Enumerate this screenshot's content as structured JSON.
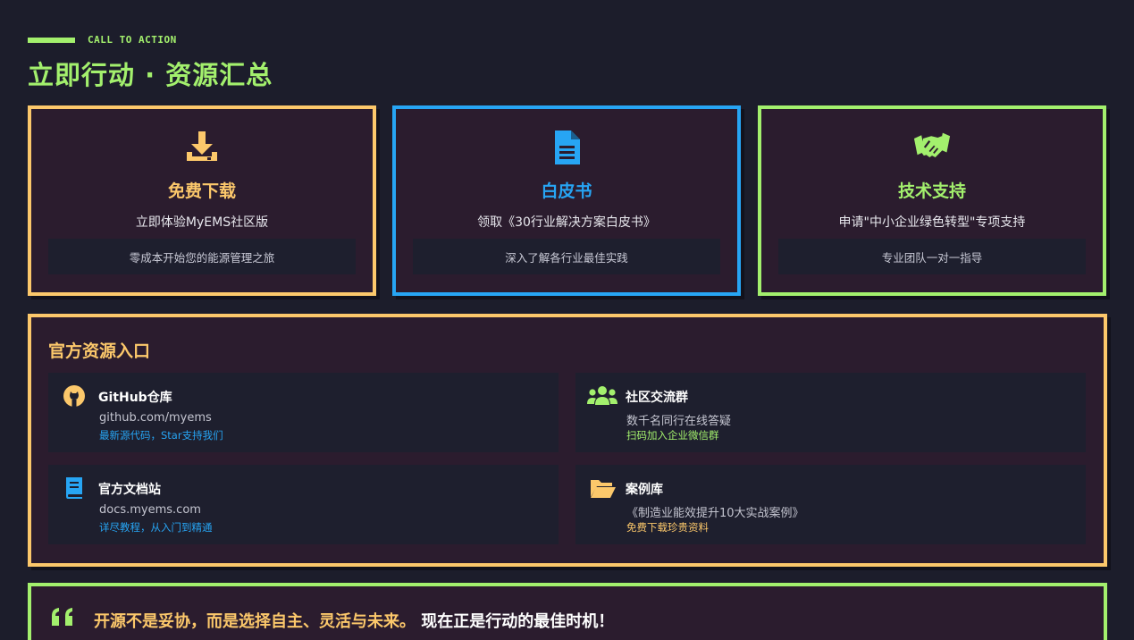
{
  "header": {
    "eyebrow": "CALL TO ACTION",
    "title": "立即行动 · 资源汇总"
  },
  "cards": [
    {
      "icon": "download-icon",
      "title": "免费下载",
      "subtitle": "立即体验MyEMS社区版",
      "note": "零成本开始您的能源管理之旅",
      "color": "#fcc86b"
    },
    {
      "icon": "document-icon",
      "title": "白皮书",
      "subtitle": "领取《30行业解决方案白皮书》",
      "note": "深入了解各行业最佳实践",
      "color": "#27a5f4"
    },
    {
      "icon": "handshake-icon",
      "title": "技术支持",
      "subtitle": "申请\"中小企业绿色转型\"专项支持",
      "note": "专业团队一对一指导",
      "color": "#a3f06d"
    }
  ],
  "resources": {
    "title": "官方资源入口",
    "items": [
      {
        "icon": "github-icon",
        "name": "GitHub仓库",
        "line": "github.com/myems",
        "link": "最新源代码，Star支持我们",
        "color": "#27a5f4"
      },
      {
        "icon": "users-icon",
        "name": "社区交流群",
        "line": "数千名同行在线答疑",
        "link": "扫码加入企业微信群",
        "color": "#a3f06d"
      },
      {
        "icon": "book-icon",
        "name": "官方文档站",
        "line": "docs.myems.com",
        "link": "详尽教程，从入门到精通",
        "color": "#27a5f4"
      },
      {
        "icon": "folder-icon",
        "name": "案例库",
        "line": "《制造业能效提升10大实战案例》",
        "link": "免费下载珍贵资料",
        "color": "#fcc86b"
      }
    ]
  },
  "quote": {
    "icon": "quote-icon",
    "highlight": "开源不是妥协，而是选择自主、灵活与未来。",
    "tail": "现在正是行动的最佳时机！"
  },
  "colors": {
    "background": "#1c1d2b",
    "panel": "#2b1c2e",
    "green": "#a3f06d",
    "orange": "#fcc86b",
    "blue": "#27a5f4"
  }
}
